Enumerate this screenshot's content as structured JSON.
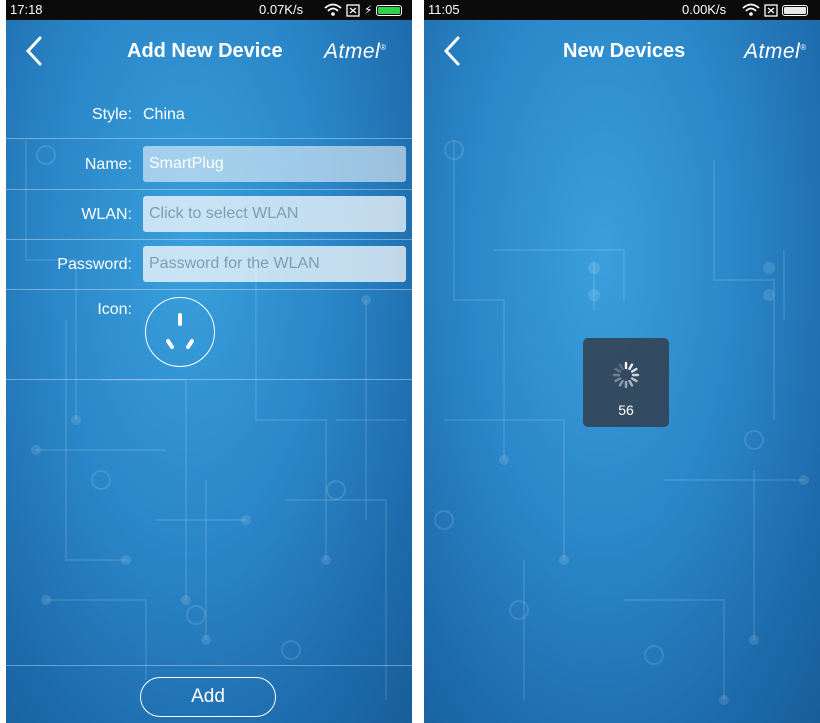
{
  "left": {
    "status": {
      "time": "17:18",
      "speed": "0.07K/s"
    },
    "title": "Add New Device",
    "logo": "Atmel",
    "form": {
      "style_label": "Style:",
      "style_value": "China",
      "name_label": "Name:",
      "name_value": "SmartPlug",
      "wlan_label": "WLAN:",
      "wlan_placeholder": "Click to select WLAN",
      "password_label": "Password:",
      "password_placeholder": "Password for the WLAN",
      "icon_label": "Icon:"
    },
    "add_button": "Add",
    "icons": [
      "back-chevron-icon",
      "wifi-icon",
      "sim-icon",
      "charging-icon",
      "battery-icon",
      "power-plug-icon"
    ]
  },
  "right": {
    "status": {
      "time": "11:05",
      "speed": "0.00K/s"
    },
    "title": "New Devices",
    "logo": "Atmel",
    "loading_count": "56",
    "icons": [
      "back-chevron-icon",
      "wifi-icon",
      "sim-icon",
      "battery-icon",
      "spinner-icon"
    ]
  }
}
